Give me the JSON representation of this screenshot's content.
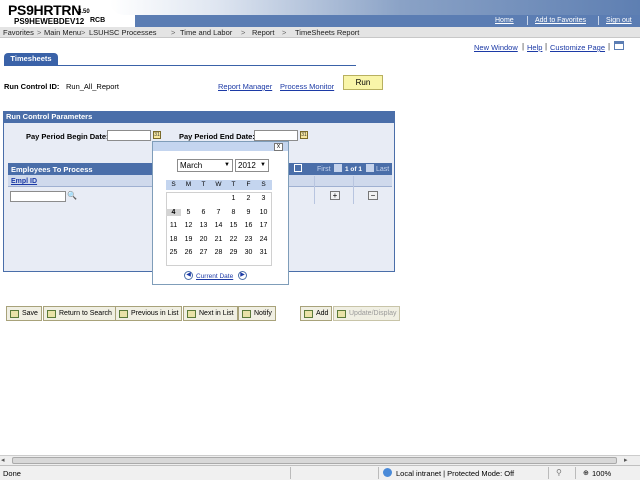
{
  "header": {
    "app_name": "PS9HRTRN",
    "app_version": "8.50",
    "db_name": "PS9HEWEBDEV12",
    "db_user": "RCB",
    "links": {
      "home": "Home",
      "favorites": "Add to Favorites",
      "signout": "Sign out"
    }
  },
  "nav": {
    "items": [
      "Favorites",
      "Main Menu",
      "LSUHSC Processes",
      "Time and Labor",
      "Report",
      "TimeSheets Report"
    ],
    "separator": ">"
  },
  "page_links": {
    "new_window": "New Window",
    "help": "Help",
    "customize": "Customize Page"
  },
  "tab": {
    "label": "Timesheets"
  },
  "run_control": {
    "label": "Run Control ID:",
    "value": "Run_All_Report",
    "report_manager": "Report Manager",
    "process_monitor": "Process Monitor",
    "run_button": "Run"
  },
  "params": {
    "title": "Run Control Parameters",
    "begin_label": "Pay Period Begin Date:",
    "begin_value": "",
    "end_label": "Pay Period End Date:",
    "end_value": ""
  },
  "employees": {
    "title": "Employees To Process",
    "nav_first": "First",
    "nav_count": "1 of 1",
    "nav_last": "Last",
    "column": "Empl ID",
    "row_value": "",
    "add": "+",
    "delete": "−"
  },
  "calendar": {
    "close": "x",
    "month": "March",
    "year": "2012",
    "dow": [
      "S",
      "M",
      "T",
      "W",
      "T",
      "F",
      "S"
    ],
    "weeks": [
      [
        "",
        "",
        "",
        "",
        "1",
        "2",
        "3"
      ],
      [
        "4",
        "5",
        "6",
        "7",
        "8",
        "9",
        "10"
      ],
      [
        "11",
        "12",
        "13",
        "14",
        "15",
        "16",
        "17"
      ],
      [
        "18",
        "19",
        "20",
        "21",
        "22",
        "23",
        "24"
      ],
      [
        "25",
        "26",
        "27",
        "28",
        "29",
        "30",
        "31"
      ]
    ],
    "selected_day": "4",
    "current_date": "Current Date"
  },
  "toolbar": {
    "save": "Save",
    "return": "Return to Search",
    "previous": "Previous in List",
    "next": "Next in List",
    "notify": "Notify",
    "add": "Add",
    "update": "Update/Display"
  },
  "status": {
    "text": "Done",
    "zone": "Local intranet | Protected Mode: Off",
    "zoom": "100%"
  }
}
